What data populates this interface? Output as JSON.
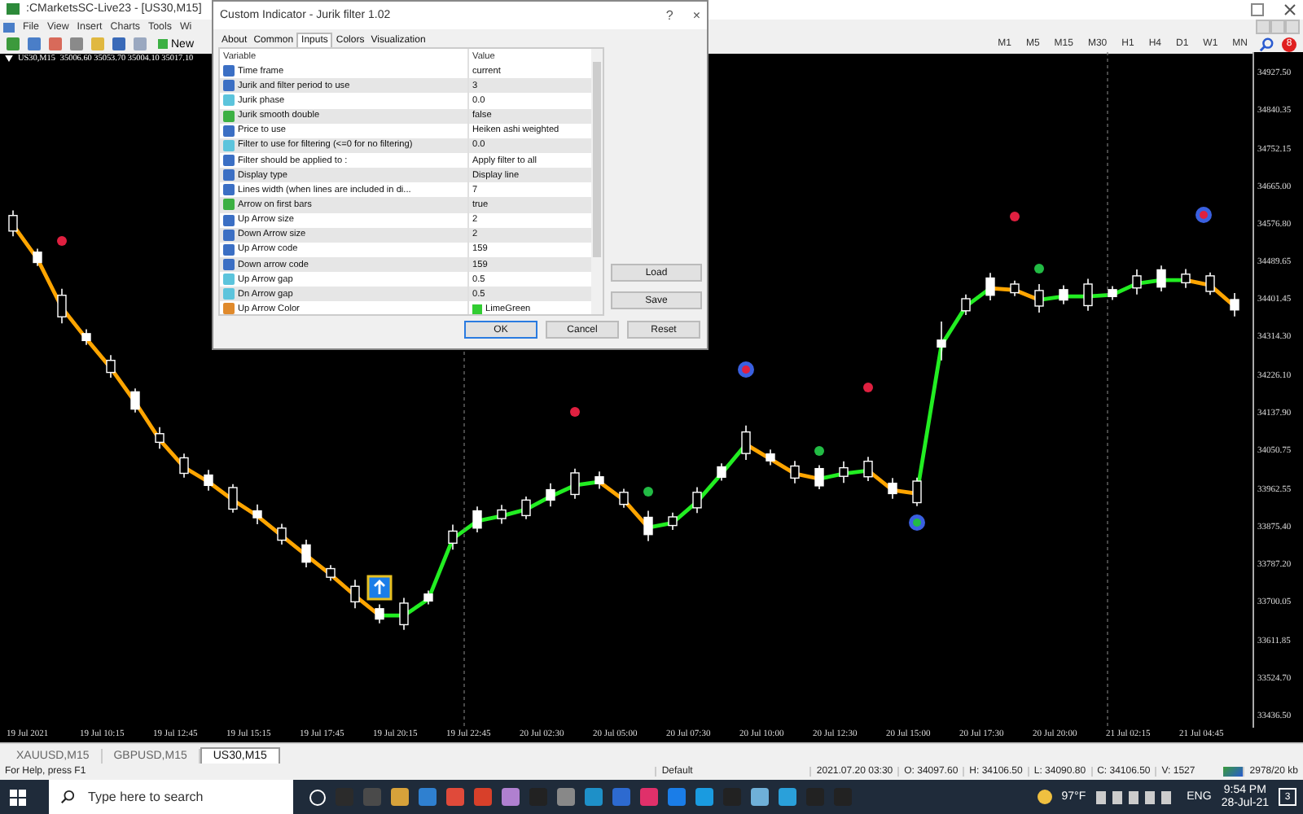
{
  "window": {
    "title": ":CMarketsSC-Live23 - [US30,M15]"
  },
  "menu": [
    "File",
    "View",
    "Insert",
    "Charts",
    "Tools",
    "Wi"
  ],
  "toolbar": {
    "new_order": "New",
    "timeframes": [
      "M1",
      "M5",
      "M15",
      "M30",
      "H1",
      "H4",
      "D1",
      "W1",
      "MN"
    ],
    "notifications": "8"
  },
  "chart": {
    "header_symbol": "US30,M15",
    "header_prices": "35006.60 35053.70 35004.10 35017.10",
    "chart_data": {
      "type": "candlestick",
      "ylim": [
        33410,
        34977
      ],
      "yticks": [
        {
          "value": 34927.5,
          "label": "34927.50"
        },
        {
          "value": 34840.35,
          "label": "34840.35"
        },
        {
          "value": 34752.15,
          "label": "34752.15"
        },
        {
          "value": 34665,
          "label": "34665.00"
        },
        {
          "value": 34576.8,
          "label": "34576.80"
        },
        {
          "value": 34489.65,
          "label": "34489.65"
        },
        {
          "value": 34401.45,
          "label": "34401.45"
        },
        {
          "value": 34314.3,
          "label": "34314.30"
        },
        {
          "value": 34226.1,
          "label": "34226.10"
        },
        {
          "value": 34137.9,
          "label": "34137.90"
        },
        {
          "value": 34050.75,
          "label": "34050.75"
        },
        {
          "value": 33962.55,
          "label": "33962.55"
        },
        {
          "value": 33875.4,
          "label": "33875.40"
        },
        {
          "value": 33787.2,
          "label": "33787.20"
        },
        {
          "value": 33700.05,
          "label": "33700.05"
        },
        {
          "value": 33611.85,
          "label": "33611.85"
        },
        {
          "value": 33524.7,
          "label": "33524.70"
        },
        {
          "value": 33436.5,
          "label": "33436.50"
        }
      ],
      "ohlc": [
        [
          34598,
          34610,
          34550,
          34562
        ],
        [
          34489,
          34521,
          34481,
          34513
        ],
        [
          34413,
          34428,
          34348,
          34363
        ],
        [
          34308,
          34334,
          34298,
          34324
        ],
        [
          34262,
          34274,
          34222,
          34234
        ],
        [
          34149,
          34197,
          34141,
          34189
        ],
        [
          34092,
          34107,
          34057,
          34072
        ],
        [
          34036,
          34046,
          33990,
          34000
        ],
        [
          33972,
          34008,
          33960,
          33996
        ],
        [
          33967,
          33975,
          33909,
          33917
        ],
        [
          33897,
          33928,
          33882,
          33913
        ],
        [
          33873,
          33883,
          33835,
          33845
        ],
        [
          33794,
          33846,
          33782,
          33834
        ],
        [
          33779,
          33787,
          33751,
          33759
        ],
        [
          33738,
          33753,
          33687,
          33702
        ],
        [
          33662,
          33696,
          33652,
          33686
        ],
        [
          33699,
          33711,
          33637,
          33649
        ],
        [
          33704,
          33728,
          33696,
          33720
        ],
        [
          33866,
          33881,
          33823,
          33838
        ],
        [
          33873,
          33923,
          33863,
          33913
        ],
        [
          33915,
          33927,
          33883,
          33895
        ],
        [
          33938,
          33946,
          33894,
          33902
        ],
        [
          33938,
          33977,
          33923,
          33962
        ],
        [
          34001,
          34011,
          33941,
          33951
        ],
        [
          33976,
          34004,
          33964,
          33992
        ],
        [
          33956,
          33964,
          33920,
          33928
        ],
        [
          33858,
          33913,
          33843,
          33898
        ],
        [
          33899,
          33909,
          33869,
          33879
        ],
        [
          33956,
          33968,
          33908,
          33920
        ],
        [
          33991,
          34023,
          33983,
          34015
        ],
        [
          34096,
          34111,
          34031,
          34046
        ],
        [
          34029,
          34055,
          34019,
          34045
        ],
        [
          34017,
          34029,
          33977,
          33989
        ],
        [
          33971,
          34019,
          33963,
          34011
        ],
        [
          34013,
          34028,
          33978,
          33993
        ],
        [
          34028,
          34038,
          33982,
          33992
        ],
        [
          33953,
          33989,
          33941,
          33977
        ],
        [
          33982,
          33990,
          33924,
          33932
        ],
        [
          34293,
          34352,
          34262,
          34309
        ],
        [
          34405,
          34415,
          34367,
          34377
        ],
        [
          34413,
          34465,
          34401,
          34453
        ],
        [
          34439,
          34447,
          34411,
          34419
        ],
        [
          34424,
          34439,
          34373,
          34388
        ],
        [
          34402,
          34436,
          34392,
          34426
        ],
        [
          34439,
          34451,
          34377,
          34389
        ],
        [
          34410,
          34434,
          34402,
          34426
        ],
        [
          34458,
          34473,
          34415,
          34430
        ],
        [
          34432,
          34482,
          34422,
          34472
        ],
        [
          34462,
          34474,
          34430,
          34442
        ],
        [
          34458,
          34466,
          34414,
          34422
        ],
        [
          34379,
          34418,
          34364,
          34403
        ]
      ]
    },
    "time_labels": [
      "19 Jul 2021",
      "19 Jul 10:15",
      "19 Jul 12:45",
      "19 Jul 15:15",
      "19 Jul 17:45",
      "19 Jul 20:15",
      "19 Jul 22:45",
      "20 Jul 02:30",
      "20 Jul 05:00",
      "20 Jul 07:30",
      "20 Jul 10:00",
      "20 Jul 12:30",
      "20 Jul 15:00",
      "20 Jul 17:30",
      "20 Jul 20:00",
      "21 Jul 02:15",
      "21 Jul 04:45"
    ]
  },
  "dialog": {
    "title": "Custom Indicator - Jurik filter 1.02",
    "help": "?",
    "close": "×",
    "tabs": [
      {
        "label": "About",
        "selected": false
      },
      {
        "label": "Common",
        "selected": false
      },
      {
        "label": "Inputs",
        "selected": true
      },
      {
        "label": "Colors",
        "selected": false
      },
      {
        "label": "Visualization",
        "selected": false
      }
    ],
    "columns": [
      "Variable",
      "Value"
    ],
    "rows": [
      {
        "kind": "int",
        "variable": "Time frame",
        "value": "current"
      },
      {
        "kind": "int",
        "variable": "Jurik and filter period to use",
        "value": "3"
      },
      {
        "kind": "double",
        "variable": "Jurik phase",
        "value": "0.0"
      },
      {
        "kind": "bool",
        "variable": "Jurik smooth double",
        "value": "false"
      },
      {
        "kind": "int",
        "variable": "Price to use",
        "value": "Heiken ashi weighted"
      },
      {
        "kind": "double",
        "variable": "Filter to use for filtering (<=0 for no filtering)",
        "value": "0.0"
      },
      {
        "kind": "int",
        "variable": "Filter should be applied to :",
        "value": "Apply filter to all"
      },
      {
        "kind": "int",
        "variable": "Display type",
        "value": "Display line"
      },
      {
        "kind": "int",
        "variable": "Lines width (when lines are included in di...",
        "value": "7"
      },
      {
        "kind": "bool",
        "variable": "Arrow on first bars",
        "value": "true"
      },
      {
        "kind": "int",
        "variable": "Up Arrow size",
        "value": "2"
      },
      {
        "kind": "int",
        "variable": "Down Arrow size",
        "value": "2"
      },
      {
        "kind": "int",
        "variable": "Up Arrow code",
        "value": "159"
      },
      {
        "kind": "int",
        "variable": "Down arrow code",
        "value": "159"
      },
      {
        "kind": "double",
        "variable": "Up Arrow gap",
        "value": "0.5"
      },
      {
        "kind": "double",
        "variable": "Dn Arrow gap",
        "value": "0.5"
      },
      {
        "kind": "color",
        "variable": "Up Arrow Color",
        "value": "LimeGreen",
        "color": "#32cd32"
      }
    ],
    "side_buttons": [
      "Load",
      "Save"
    ],
    "buttons": [
      "OK",
      "Cancel",
      "Reset"
    ]
  },
  "chart_tabs": [
    {
      "label": "XAUUSD,M15",
      "selected": false
    },
    {
      "label": "GBPUSD,M15",
      "selected": false
    },
    {
      "label": "US30,M15",
      "selected": true
    }
  ],
  "status_bar": {
    "help": "For Help, press F1",
    "profile": "Default",
    "time": "2021.07.20 03:30",
    "open": "O: 34097.60",
    "high": "H: 34106.50",
    "low": "L: 34090.80",
    "close": "C: 34106.50",
    "volume": "V: 1527",
    "traffic": "2978/20 kb"
  },
  "taskbar": {
    "search_placeholder": "Type here to search",
    "weather": "97°F",
    "language": "ENG",
    "time": "9:54 PM",
    "date": "28-Jul-21",
    "notifications": "3"
  }
}
